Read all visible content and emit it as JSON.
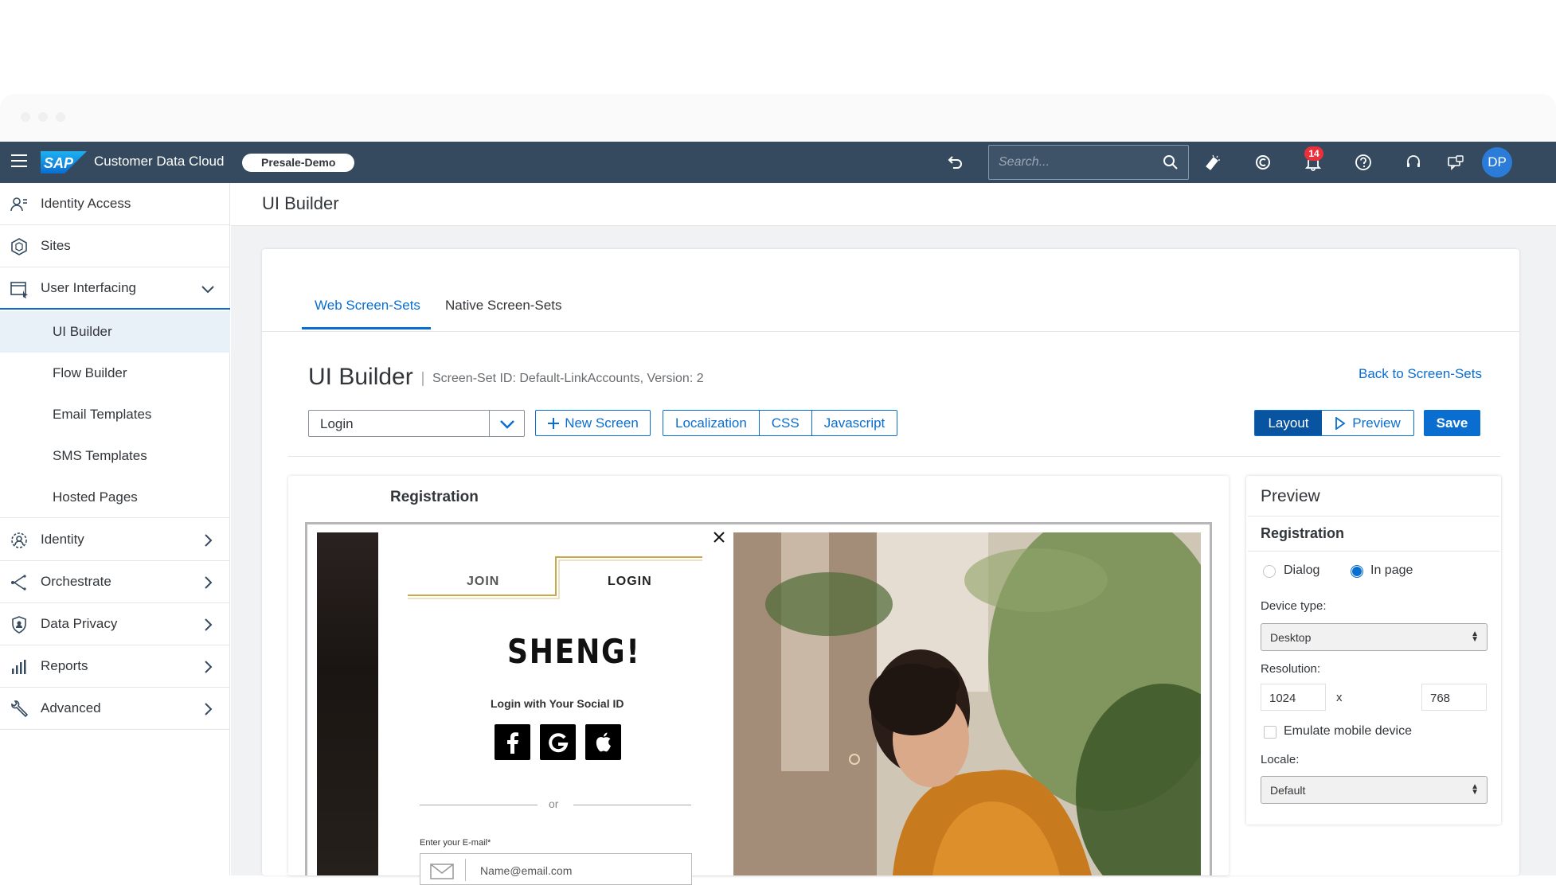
{
  "shell": {
    "app_title": "Customer Data Cloud",
    "tenant": "Presale-Demo",
    "search_placeholder": "Search...",
    "notification_count": "14",
    "avatar_initials": "DP",
    "icons": [
      "menu-icon",
      "back-icon",
      "search-icon",
      "wand-icon",
      "copyright-icon",
      "bell-icon",
      "help-icon",
      "headset-icon",
      "feedback-icon"
    ],
    "colors": {
      "shell": "#354a5f",
      "accent": "#0a6ed1",
      "badge": "#e9303b",
      "avatar": "#2b7cd9"
    }
  },
  "sidebar": {
    "top_items": [
      {
        "label": "Identity Access",
        "icon": "identity-access-icon"
      },
      {
        "label": "Sites",
        "icon": "sites-icon"
      },
      {
        "label": "User Interfacing",
        "icon": "user-interfacing-icon",
        "expanded": true
      }
    ],
    "sub_items": [
      {
        "label": "UI Builder",
        "selected": true
      },
      {
        "label": "Flow Builder"
      },
      {
        "label": "Email Templates"
      },
      {
        "label": "SMS Templates"
      },
      {
        "label": "Hosted Pages"
      }
    ],
    "bottom_items": [
      {
        "label": "Identity",
        "icon": "identity-icon"
      },
      {
        "label": "Orchestrate",
        "icon": "orchestrate-icon"
      },
      {
        "label": "Data Privacy",
        "icon": "shield-icon"
      },
      {
        "label": "Reports",
        "icon": "chart-icon"
      },
      {
        "label": "Advanced",
        "icon": "wrench-icon"
      }
    ]
  },
  "page": {
    "header_title": "UI Builder",
    "tabs": [
      {
        "label": "Web Screen-Sets",
        "active": true
      },
      {
        "label": "Native Screen-Sets"
      }
    ],
    "title": "UI Builder",
    "meta": "Screen-Set ID: Default-LinkAccounts,  Version: 2",
    "back_link": "Back to Screen-Sets"
  },
  "toolbar": {
    "screen_select": "Login",
    "new_screen": "New Screen",
    "group": [
      "Localization",
      "CSS",
      "Javascript"
    ],
    "layout": "Layout",
    "preview": "Preview",
    "save": "Save"
  },
  "editor": {
    "title": "Registration",
    "join": "JOIN",
    "login": "LOGIN",
    "brand": "SHENG!",
    "social_label": "Login with Your Social ID",
    "social": [
      "facebook-icon",
      "google-icon",
      "apple-icon"
    ],
    "or": "or",
    "email_label": "Enter your E-mail*",
    "email_placeholder": "Name@email.com"
  },
  "preview_panel": {
    "title": "Preview",
    "subtitle": "Registration",
    "mode_dialog": "Dialog",
    "mode_inpage": "In page",
    "mode_selected": "In page",
    "device_label": "Device type:",
    "device_value": "Desktop",
    "resolution_label": "Resolution:",
    "res_width": "1024",
    "res_x": "x",
    "res_height": "768",
    "emulate_label": "Emulate mobile device",
    "emulate_checked": false,
    "locale_label": "Locale:",
    "locale_value": "Default"
  }
}
